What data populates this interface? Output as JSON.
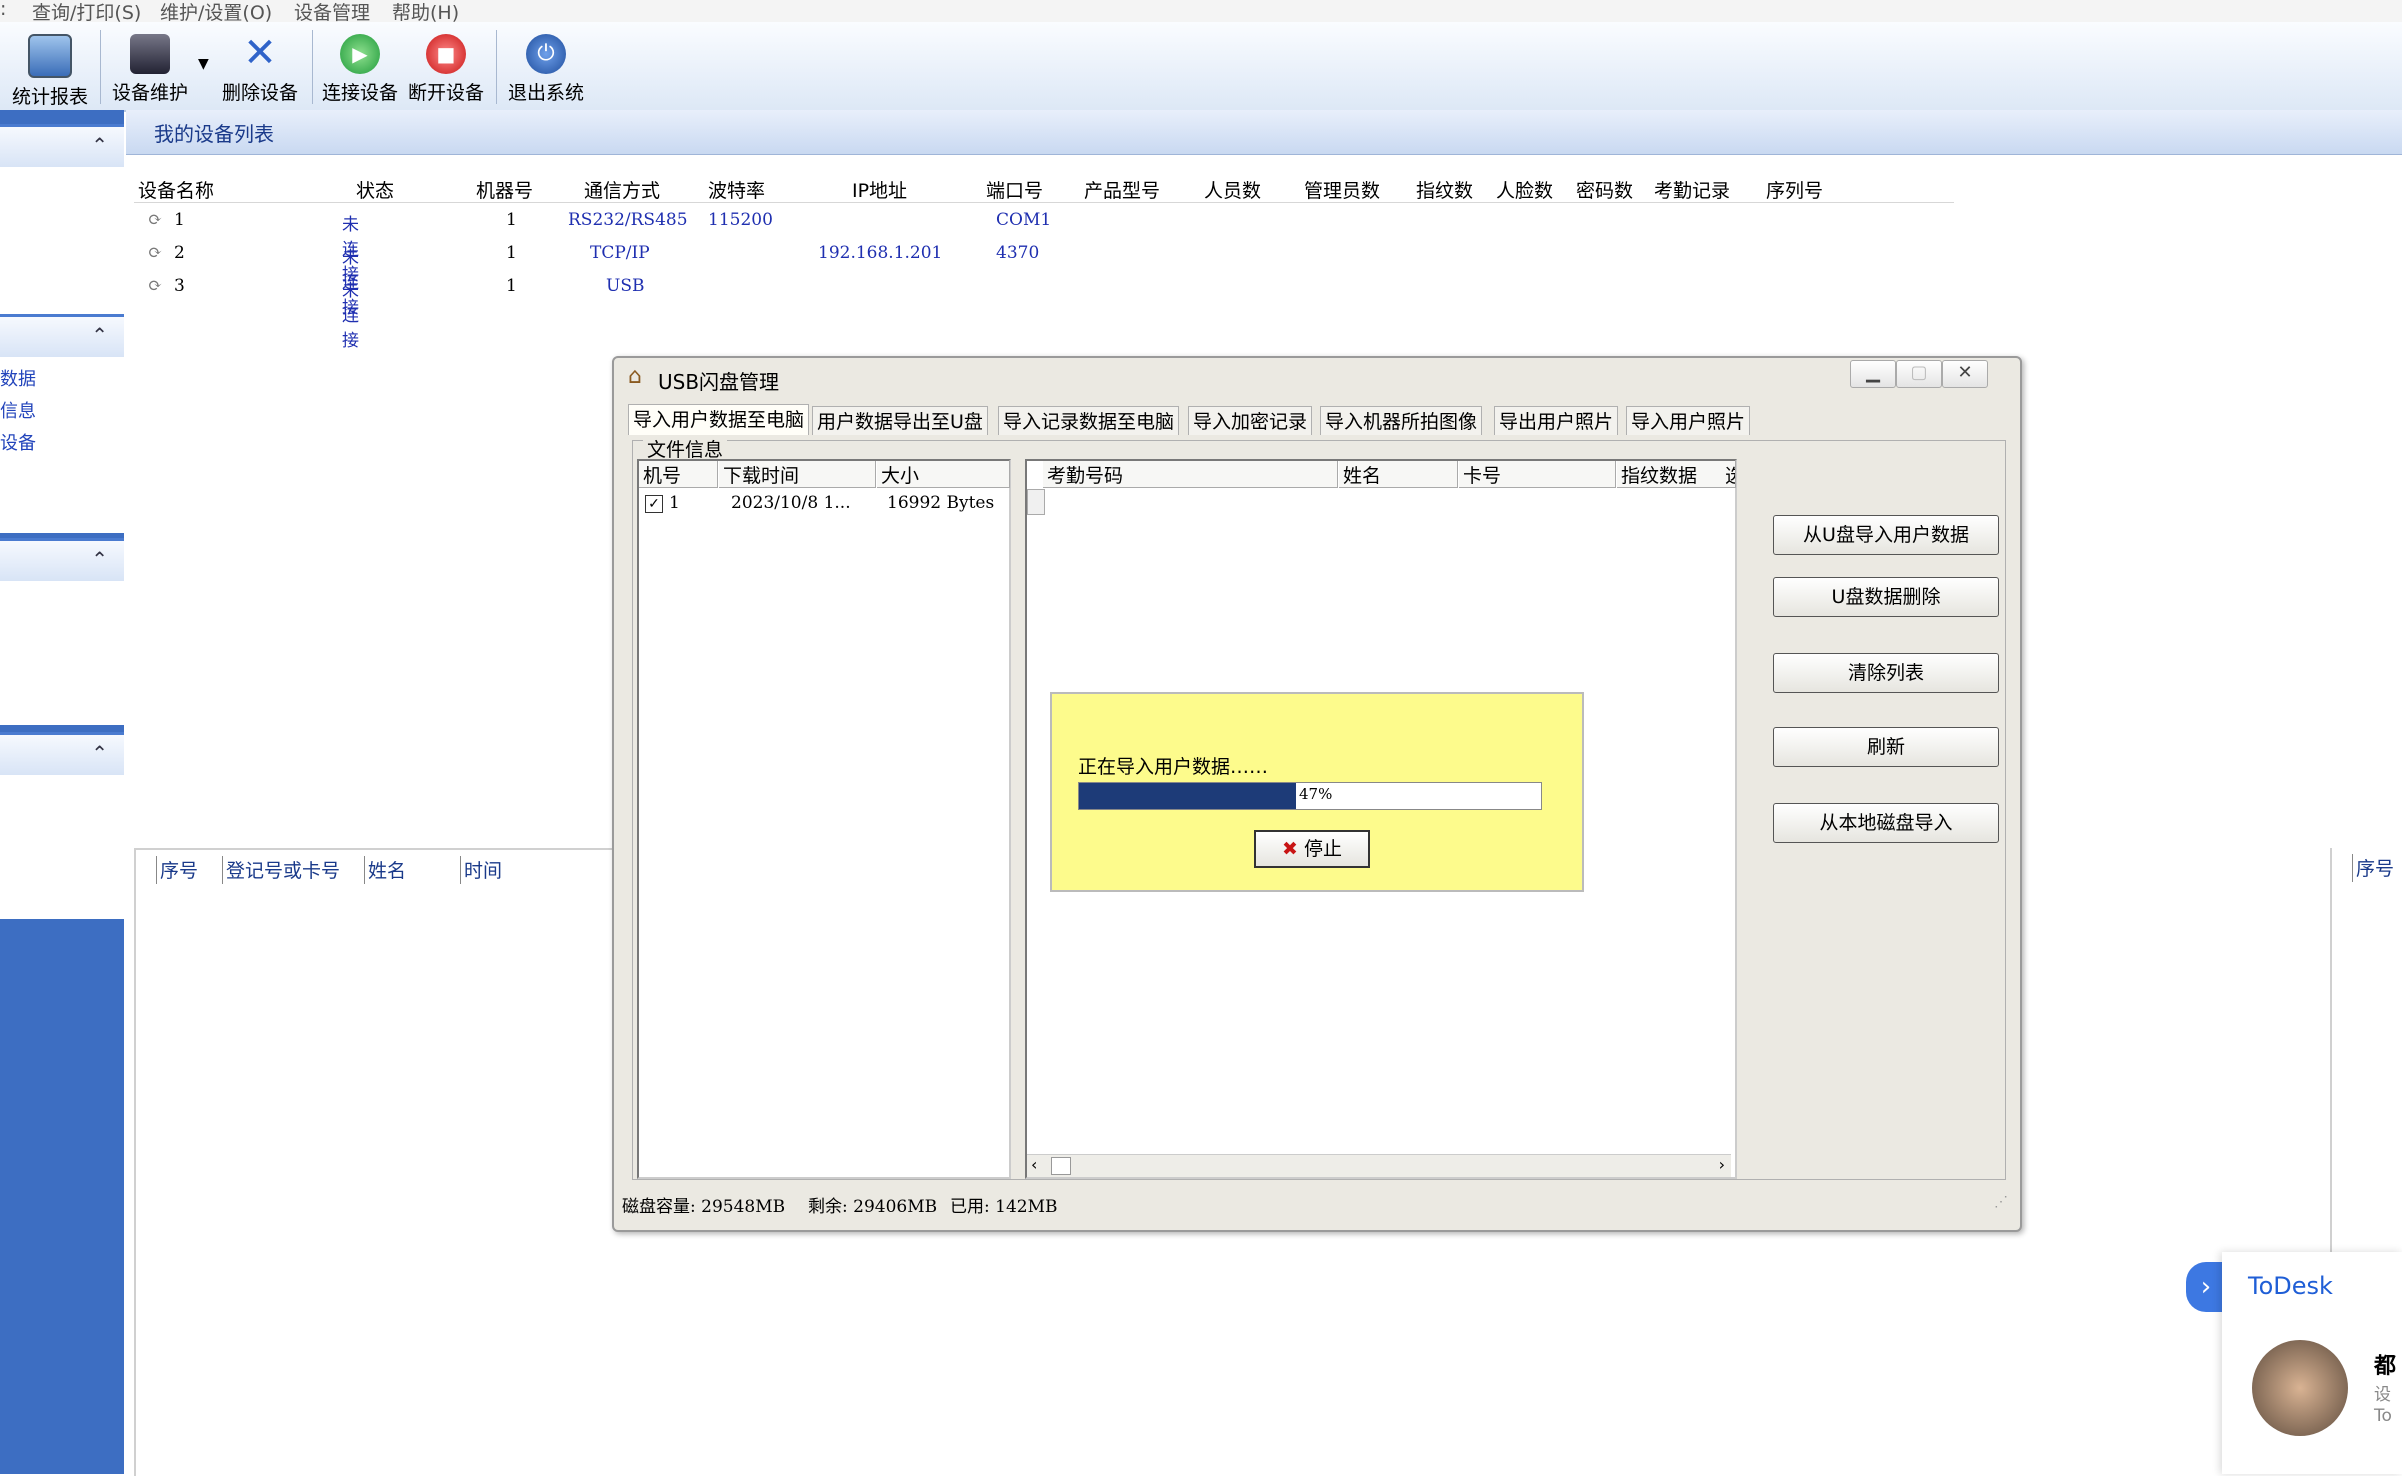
{
  "menubar": {
    "items": [
      "查询/打印(S)",
      "维护/设置(O)",
      "设备管理",
      "帮助(H)"
    ]
  },
  "toolbar": {
    "buttons": [
      "统计报表",
      "设备维护",
      "删除设备",
      "连接设备",
      "断开设备",
      "退出系统"
    ]
  },
  "left_panel": {
    "links": [
      "数据",
      "信息",
      "设备"
    ]
  },
  "main": {
    "title": "我的设备列表",
    "columns": [
      "设备名称",
      "状态",
      "机器号",
      "通信方式",
      "波特率",
      "IP地址",
      "端口号",
      "产品型号",
      "人员数",
      "管理员数",
      "指纹数",
      "人脸数",
      "密码数",
      "考勤记录",
      "序列号"
    ],
    "rows": [
      {
        "name": "1",
        "status": "未连接",
        "machine": "1",
        "comm": "RS232/RS485",
        "baud": "115200",
        "ip": "",
        "port": "COM1"
      },
      {
        "name": "2",
        "status": "未连接",
        "machine": "1",
        "comm": "TCP/IP",
        "baud": "",
        "ip": "192.168.1.201",
        "port": "4370"
      },
      {
        "name": "3",
        "status": "未连接",
        "machine": "1",
        "comm": "USB",
        "baud": "",
        "ip": "",
        "port": ""
      }
    ],
    "bottom_columns": [
      "序号",
      "登记号或卡号",
      "姓名",
      "时间"
    ],
    "right_column": "序号"
  },
  "dialog": {
    "title": "USB闪盘管理",
    "tabs": [
      "导入用户数据至电脑",
      "用户数据导出至U盘",
      "导入记录数据至电脑",
      "导入加密记录",
      "导入机器所拍图像",
      "导出用户照片",
      "导入用户照片"
    ],
    "group_label": "文件信息",
    "left_columns": [
      "机号",
      "下载时间",
      "大小"
    ],
    "left_row": {
      "machine": "1",
      "time": "2023/10/8 1...",
      "size": "16992 Bytes"
    },
    "right_columns": [
      "考勤号码",
      "姓名",
      "卡号",
      "指纹数据",
      "选"
    ],
    "side_buttons": [
      "从U盘导入用户数据",
      "U盘数据删除",
      "清除列表",
      "刷新",
      "从本地磁盘导入"
    ],
    "status": {
      "capacity": "磁盘容量: 29548MB",
      "free": "剩余: 29406MB",
      "used": "已用: 142MB"
    },
    "progress": {
      "message": "正在导入用户数据……",
      "percent_label": "47%",
      "value": 0.47,
      "stop_label": "停止"
    }
  },
  "todesk": {
    "brand": "ToDesk",
    "name": "都",
    "line1": "设",
    "line2": "To"
  },
  "colors": {
    "accent": "#3d6ec2",
    "progress": "#1d3b78",
    "popup": "#fdfb8c",
    "status_text": "#1f2fb0"
  }
}
